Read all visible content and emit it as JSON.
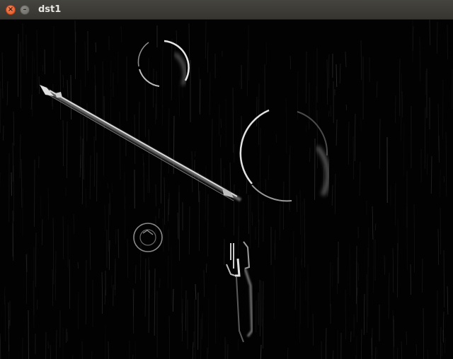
{
  "window": {
    "title": "dst1",
    "close_glyph": "×",
    "minimize_glyph": "–"
  },
  "icons": {
    "close": "close-icon",
    "minimize": "minimize-icon"
  },
  "colors": {
    "titlebar": "#3c3b37",
    "close_button": "#e95420",
    "canvas_background": "#020202",
    "edge_highlight": "#d8d8d8"
  }
}
